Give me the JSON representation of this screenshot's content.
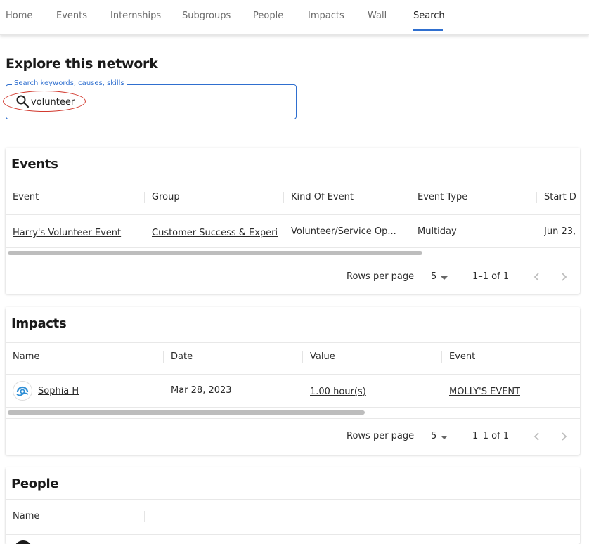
{
  "nav": {
    "tabs": [
      "Home",
      "Events",
      "Internships",
      "Subgroups",
      "People",
      "Impacts",
      "Wall",
      "Search"
    ],
    "active": "Search"
  },
  "page": {
    "heading": "Explore this network",
    "search_label": "Search keywords, causes, skills",
    "search_value": "volunteer"
  },
  "events": {
    "title": "Events",
    "columns": [
      "Event",
      "Group",
      "Kind Of Event",
      "Event Type",
      "Start D"
    ],
    "rows": [
      {
        "event": "Harry's Volunteer Event",
        "group": "Customer Success & Experi",
        "kind": "Volunteer/Service Op...",
        "type": "Multiday",
        "start": "Jun 23,"
      }
    ],
    "rows_per_page_label": "Rows per page",
    "rows_per_page": "5",
    "range": "1–1 of 1"
  },
  "impacts": {
    "title": "Impacts",
    "columns": [
      "Name",
      "Date",
      "Value",
      "Event"
    ],
    "rows": [
      {
        "name": "Sophia H",
        "date": "Mar 28, 2023",
        "value": "1.00 hour(s)",
        "event": "MOLLY'S EVENT"
      }
    ],
    "rows_per_page_label": "Rows per page",
    "rows_per_page": "5",
    "range": "1–1 of 1"
  },
  "people": {
    "title": "People",
    "columns": [
      "Name"
    ]
  },
  "colors": {
    "accent": "#2f6fcf",
    "annotation": "#d23a2f"
  }
}
